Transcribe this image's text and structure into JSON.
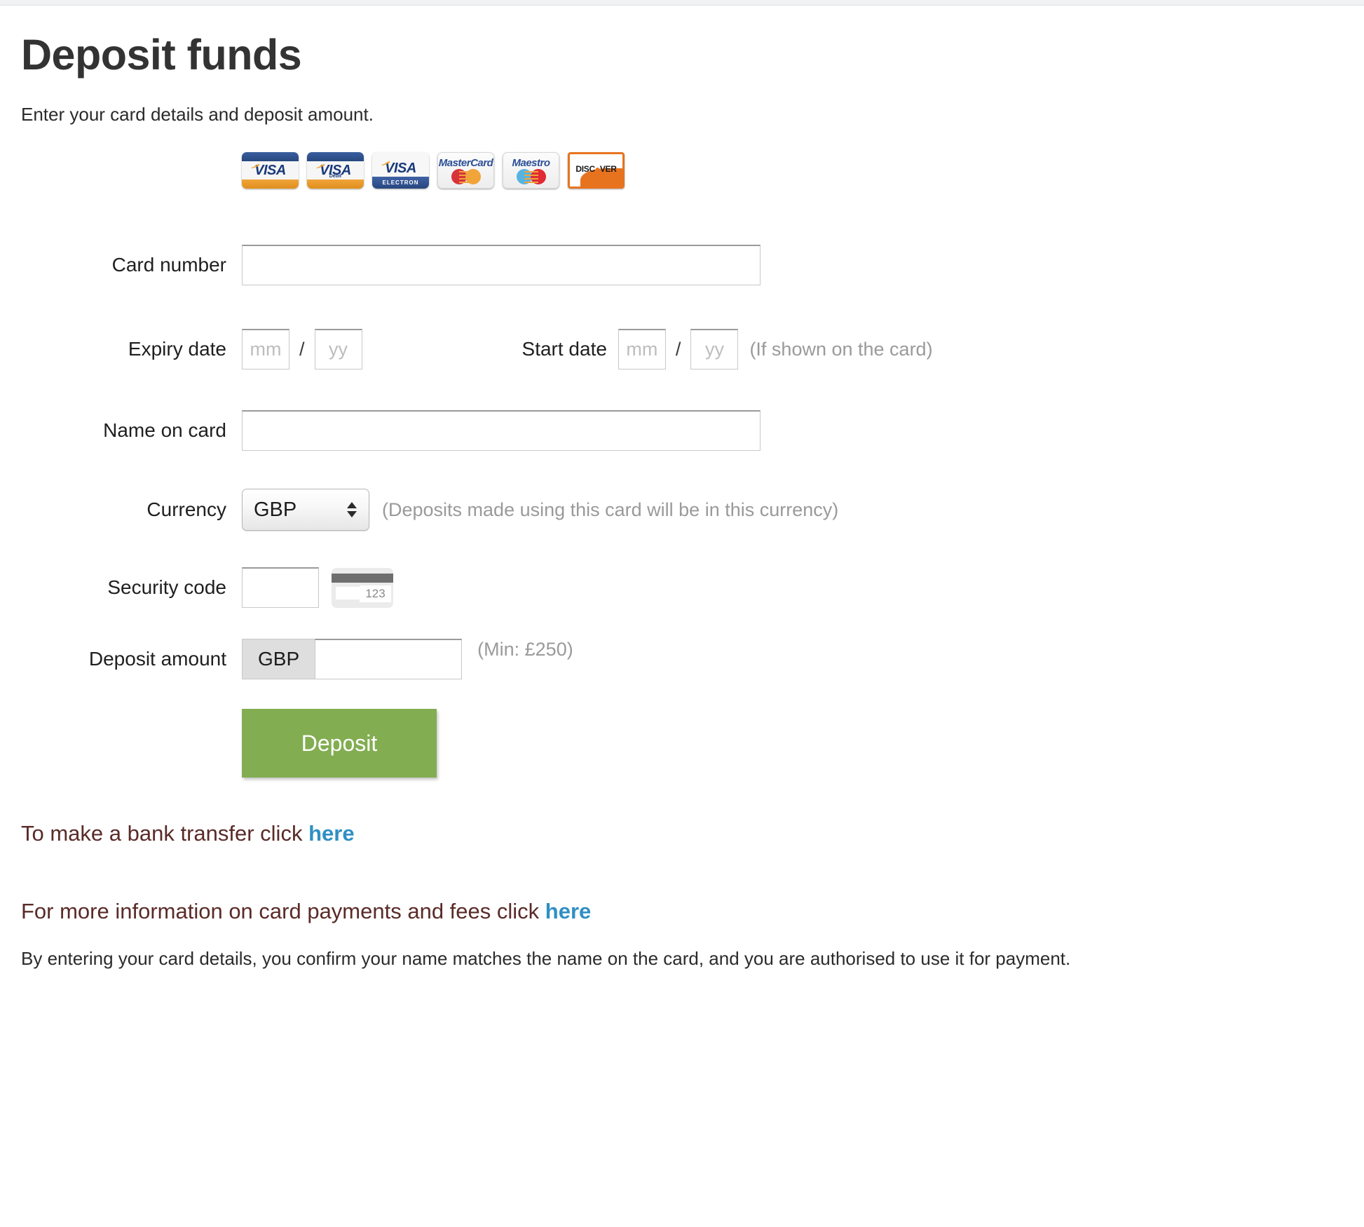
{
  "page": {
    "title": "Deposit funds",
    "subtitle": "Enter your card details and deposit amount."
  },
  "card_logos": [
    {
      "name": "visa-logo",
      "label": "VISA",
      "sub": ""
    },
    {
      "name": "visa-debit-logo",
      "label": "VISA",
      "sub": "Debit"
    },
    {
      "name": "visa-electron-logo",
      "label": "VISA",
      "sub": "ELECTRON"
    },
    {
      "name": "mastercard-logo",
      "label": "MasterCard",
      "sub": ""
    },
    {
      "name": "maestro-logo",
      "label": "Maestro",
      "sub": ""
    },
    {
      "name": "discover-logo",
      "label": "DISC",
      "sub": "VER"
    }
  ],
  "form": {
    "card_number": {
      "label": "Card number",
      "value": "",
      "placeholder": ""
    },
    "expiry": {
      "label": "Expiry date",
      "month_value": "",
      "month_placeholder": "mm",
      "separator": "/",
      "year_value": "",
      "year_placeholder": "yy"
    },
    "start": {
      "label": "Start date",
      "month_value": "",
      "month_placeholder": "mm",
      "separator": "/",
      "year_value": "",
      "year_placeholder": "yy",
      "hint": "(If shown on the card)"
    },
    "name_on_card": {
      "label": "Name on card",
      "value": "",
      "placeholder": ""
    },
    "currency": {
      "label": "Currency",
      "selected": "GBP",
      "options": [
        "GBP"
      ],
      "hint": "(Deposits made using this card will be in this currency)"
    },
    "security_code": {
      "label": "Security code",
      "value": "",
      "placeholder": "",
      "card_example_digits": "123"
    },
    "deposit_amount": {
      "label": "Deposit amount",
      "currency_prefix": "GBP",
      "value": "",
      "placeholder": "",
      "hint": "(Min: £250)"
    },
    "submit": {
      "label": "Deposit"
    }
  },
  "footer": {
    "bank_transfer_text": "To make a bank transfer click",
    "bank_transfer_link": "here",
    "more_info_text": "For more information on card payments and fees click",
    "more_info_link": "here",
    "disclaimer": "By entering your card details, you confirm your name matches the name on the card, and you are authorised to use it for payment."
  },
  "colors": {
    "accent_green": "#82ad51",
    "link_blue": "#2f8fc4",
    "heading_maroon": "#5a2b28",
    "visa_blue": "#1a3a7a",
    "visa_gold": "#f0a43a",
    "discover_orange": "#e8731f"
  }
}
